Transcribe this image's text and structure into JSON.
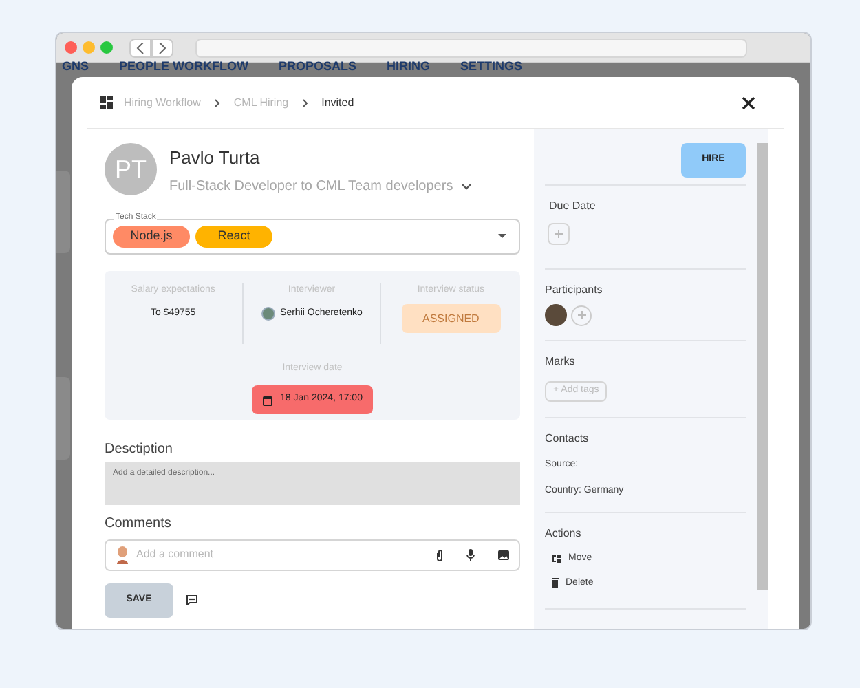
{
  "background_nav": [
    "GNS",
    "PEOPLE WORKFLOW",
    "PROPOSALS",
    "HIRING",
    "SETTINGS"
  ],
  "breadcrumbs": [
    {
      "label": "Hiring Workflow",
      "current": false
    },
    {
      "label": "CML Hiring",
      "current": false
    },
    {
      "label": "Invited",
      "current": true
    }
  ],
  "candidate": {
    "initials": "PT",
    "name": "Pavlo Turta",
    "position": "Full-Stack Developer to CML Team developers"
  },
  "tech_stack": {
    "label": "Tech Stack",
    "tags": [
      {
        "label": "Node.js",
        "color": "#ff8a65"
      },
      {
        "label": "React",
        "color": "#ffb300"
      }
    ]
  },
  "info": [
    {
      "kind": "text",
      "label": "Salary expectations",
      "value": "To $49755"
    },
    {
      "kind": "person",
      "label": "Interviewer",
      "value": "Serhii Ocheretenko"
    },
    {
      "kind": "status",
      "label": "Interview status",
      "value": "ASSIGNED"
    }
  ],
  "interview_date": {
    "label": "Interview date",
    "value": "18 Jan 2024, 17:00"
  },
  "description": {
    "label": "Desctiption",
    "placeholder": "Add a detailed description..."
  },
  "comments": {
    "label": "Comments",
    "placeholder": "Add a comment",
    "save": "SAVE"
  },
  "hire_button": "HIRE",
  "sidebar": [
    {
      "kind": "add",
      "title": "Due Date"
    },
    {
      "kind": "participants",
      "title": "Participants"
    },
    {
      "kind": "tags",
      "title": "Marks",
      "button": "+ Add tags"
    },
    {
      "kind": "lines",
      "title": "Contacts",
      "lines": [
        "Source:",
        "Country: Germany"
      ]
    },
    {
      "kind": "actions",
      "title": "Actions",
      "actions": [
        {
          "kind": "move",
          "label": "Move"
        },
        {
          "kind": "delete",
          "label": "Delete"
        }
      ]
    }
  ]
}
